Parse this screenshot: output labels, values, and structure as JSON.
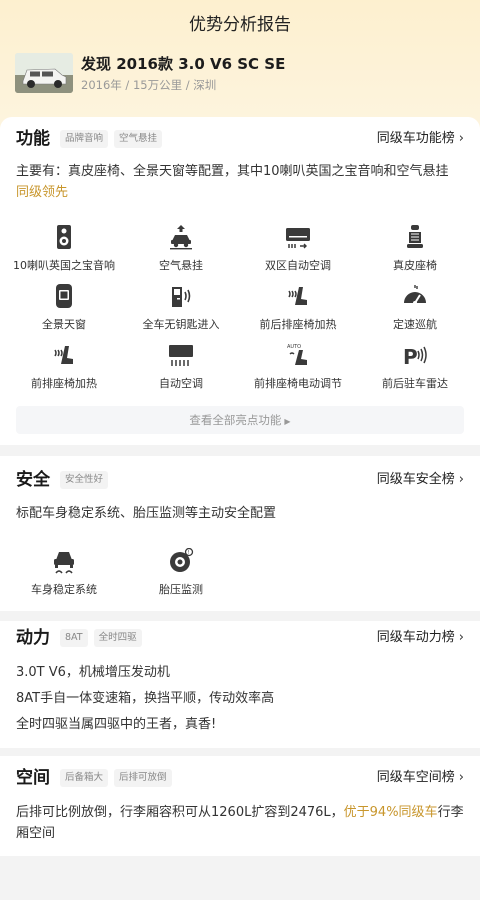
{
  "header": {
    "title": "优势分析报告"
  },
  "car": {
    "name": "发现 2016款 3.0 V6 SC SE",
    "meta": "2016年 / 15万公里 / 深圳"
  },
  "function": {
    "title": "功能",
    "tags": [
      "品牌音响",
      "空气悬挂"
    ],
    "rank_link": "同级车功能榜",
    "desc_main": "主要有：真皮座椅、全景天窗等配置，其中10喇叭英国之宝音响和空气悬挂",
    "desc_highlight": "同级领先",
    "features": [
      {
        "label": "10喇叭英国之宝音响",
        "icon": "speaker-icon"
      },
      {
        "label": "空气悬挂",
        "icon": "air-suspension-icon"
      },
      {
        "label": "双区自动空调",
        "icon": "dual-zone-ac-icon"
      },
      {
        "label": "真皮座椅",
        "icon": "leather-seat-icon"
      },
      {
        "label": "全景天窗",
        "icon": "panoramic-sunroof-icon"
      },
      {
        "label": "全车无钥匙进入",
        "icon": "keyless-entry-icon"
      },
      {
        "label": "前后排座椅加热",
        "icon": "seat-heating-icon"
      },
      {
        "label": "定速巡航",
        "icon": "cruise-control-icon"
      },
      {
        "label": "前排座椅加热",
        "icon": "front-seat-heating-icon"
      },
      {
        "label": "自动空调",
        "icon": "auto-ac-icon"
      },
      {
        "label": "前排座椅电动调节",
        "icon": "power-seat-icon"
      },
      {
        "label": "前后驻车雷达",
        "icon": "parking-radar-icon"
      }
    ],
    "more_label": "查看全部亮点功能"
  },
  "safety": {
    "title": "安全",
    "tags": [
      "安全性好"
    ],
    "rank_link": "同级车安全榜",
    "desc": "标配车身稳定系统、胎压监测等主动安全配置",
    "features": [
      {
        "label": "车身稳定系统",
        "icon": "stability-control-icon"
      },
      {
        "label": "胎压监测",
        "icon": "tire-pressure-icon"
      }
    ]
  },
  "power": {
    "title": "动力",
    "tags": [
      "8AT",
      "全时四驱"
    ],
    "rank_link": "同级车动力榜",
    "lines": [
      "3.0T V6，机械增压发动机",
      "8AT手自一体变速箱，换挡平顺，传动效率高",
      "全时四驱当属四驱中的王者，真香!"
    ]
  },
  "space": {
    "title": "空间",
    "tags": [
      "后备箱大",
      "后排可放倒"
    ],
    "rank_link": "同级车空间榜",
    "desc_pre": "后排可比例放倒，行李厢容积可从1260L扩容到2476L，",
    "desc_highlight": "优于94%同级车",
    "desc_post": "行李厢空间"
  },
  "colors": {
    "accent_gold": "#c8962c",
    "header_bg": "#fdf0cf"
  }
}
